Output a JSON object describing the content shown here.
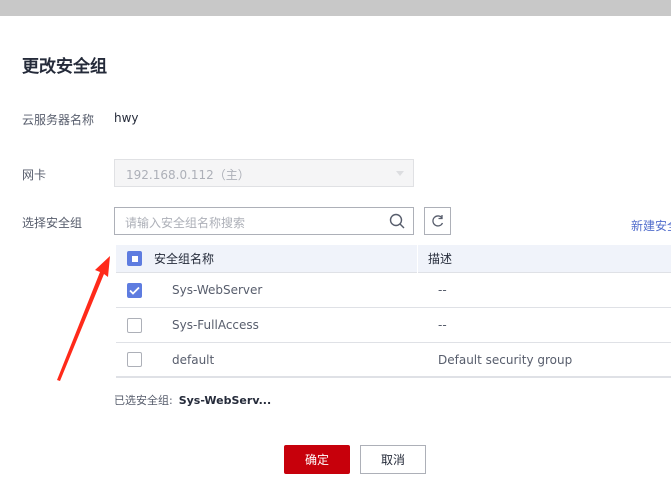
{
  "dialog": {
    "title": "更改安全组",
    "server_name_label": "云服务器名称",
    "server_name": "hwy",
    "nic_label": "网卡",
    "nic_value": "192.168.0.112（主）",
    "select_label": "选择安全组",
    "search_placeholder": "请输入安全组名称搜索",
    "create_link": "新建安全组",
    "table": {
      "headers": [
        "安全组名称",
        "描述"
      ],
      "rows": [
        {
          "name": "Sys-WebServer",
          "desc": "--",
          "checked": true
        },
        {
          "name": "Sys-FullAccess",
          "desc": "--",
          "checked": false
        },
        {
          "name": "default",
          "desc": "Default security group",
          "checked": false
        }
      ]
    },
    "selected_label": "已选安全组:",
    "selected_value": "Sys-WebServ...",
    "ok": "确定",
    "cancel": "取消"
  },
  "colors": {
    "primary": "#c7000b",
    "accent": "#5e7ce0",
    "annotation": "#ff2a1a"
  }
}
